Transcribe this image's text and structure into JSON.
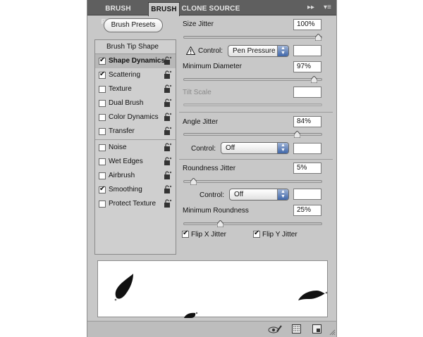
{
  "tabs": [
    {
      "label": "BRUSH PRESETS"
    },
    {
      "label": "BRUSH"
    },
    {
      "label": "CLONE SOURCE"
    }
  ],
  "tab_controls": {
    "collapse": "▸▸",
    "menu": "▾≡"
  },
  "brush_presets_button": "Brush Presets",
  "left_list": {
    "header": "Brush Tip Shape",
    "items": [
      {
        "label": "Shape Dynamics",
        "checked": true,
        "selected": true
      },
      {
        "label": "Scattering",
        "checked": true
      },
      {
        "label": "Texture",
        "checked": false
      },
      {
        "label": "Dual Brush",
        "checked": false
      },
      {
        "label": "Color Dynamics",
        "checked": false
      },
      {
        "label": "Transfer",
        "checked": false
      },
      {
        "label": "Noise",
        "checked": false
      },
      {
        "label": "Wet Edges",
        "checked": false
      },
      {
        "label": "Airbrush",
        "checked": false
      },
      {
        "label": "Smoothing",
        "checked": true
      },
      {
        "label": "Protect Texture",
        "checked": false
      }
    ]
  },
  "settings": {
    "size_jitter": {
      "label": "Size Jitter",
      "value": "100%",
      "level": 1.0
    },
    "size_control": {
      "label": "Control:",
      "value": "Pen Pressure",
      "field": ""
    },
    "min_diameter": {
      "label": "Minimum Diameter",
      "value": "97%",
      "level": 0.97
    },
    "tilt_scale": {
      "label": "Tilt Scale",
      "value": ""
    },
    "angle_jitter": {
      "label": "Angle Jitter",
      "value": "84%",
      "level": 0.84
    },
    "angle_control": {
      "label": "Control:",
      "value": "Off",
      "field": ""
    },
    "roundness_jitter": {
      "label": "Roundness Jitter",
      "value": "5%",
      "level": 0.05
    },
    "roundness_control": {
      "label": "Control:",
      "value": "Off",
      "field": ""
    },
    "min_roundness": {
      "label": "Minimum Roundness",
      "value": "25%",
      "level": 0.25
    },
    "flip_x": {
      "label": "Flip X Jitter",
      "checked": true
    },
    "flip_y": {
      "label": "Flip Y Jitter",
      "checked": true
    }
  },
  "icons": {
    "warning": "warning-icon",
    "lock": "lock-icon",
    "eye_brush": "eye-brush-icon",
    "grid": "grid-icon",
    "new_preset": "new-preset-icon"
  },
  "colors": {
    "panel_bg": "#c8c8c8",
    "tabbar_bg": "#5f5f5f",
    "select_arrow": "#3f66a8"
  }
}
